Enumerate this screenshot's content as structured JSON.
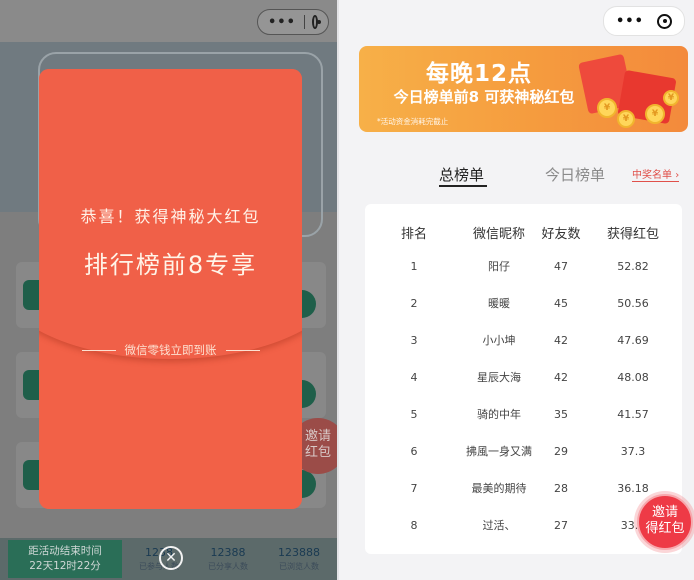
{
  "left_panel": {
    "popup": {
      "line1": "恭喜！获得神秘大红包",
      "line2": "排行榜前8专享",
      "cash_note": "微信零钱立即到账"
    },
    "invite_button": {
      "line1": "邀请",
      "line2": "红包"
    },
    "bottom_bar": {
      "countdown_label": "距活动结束时间",
      "countdown_value": "22天12时22分",
      "stats": [
        {
          "num": "1238",
          "label": "已参与人数"
        },
        {
          "num": "12388",
          "label": "已分享人数"
        },
        {
          "num": "123888",
          "label": "已浏览人数"
        }
      ]
    },
    "close_icon": "close-icon"
  },
  "right_panel": {
    "capsule": {
      "more_icon": "more-dots-icon",
      "target_icon": "target-icon"
    },
    "promo": {
      "title": "每晚12点",
      "subtitle": "今日榜单前8 可获神秘红包",
      "note": "*活动资金消耗完截止"
    },
    "tabs": {
      "total": "总榜单",
      "today": "今日榜单",
      "winners": "中奖名单"
    },
    "table": {
      "headers": {
        "rank": "排名",
        "name": "微信昵称",
        "friends": "好友数",
        "redpack": "获得红包"
      },
      "rows": [
        {
          "rank": "1",
          "name": "阳仔",
          "friends": "47",
          "redpack": "52.82"
        },
        {
          "rank": "2",
          "name": "暖暖",
          "friends": "45",
          "redpack": "50.56"
        },
        {
          "rank": "3",
          "name": "小小坤",
          "friends": "42",
          "redpack": "47.69"
        },
        {
          "rank": "4",
          "name": "星辰大海",
          "friends": "42",
          "redpack": "48.08"
        },
        {
          "rank": "5",
          "name": "骑的中年",
          "friends": "35",
          "redpack": "41.57"
        },
        {
          "rank": "6",
          "name": "拂風一身又满",
          "friends": "29",
          "redpack": "37.3"
        },
        {
          "rank": "7",
          "name": "最美的期待",
          "friends": "28",
          "redpack": "36.18"
        },
        {
          "rank": "8",
          "name": "过活、",
          "friends": "27",
          "redpack": "33.8"
        }
      ]
    },
    "invite_button": {
      "line1": "邀请",
      "line2": "得红包"
    }
  },
  "colors": {
    "popup_red": "#f26147",
    "promo_orange": "#f59b3e",
    "accent_red": "#e0504a",
    "invite_red": "#ee3a46"
  }
}
